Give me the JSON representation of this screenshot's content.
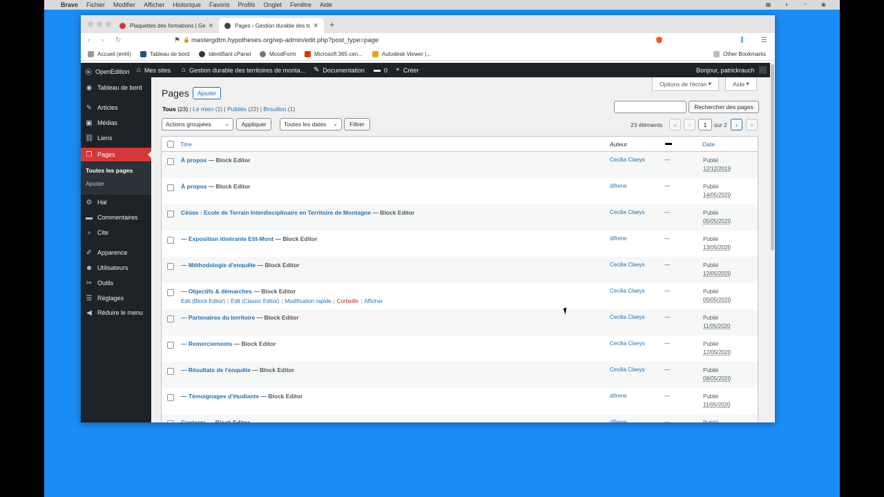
{
  "macmenu": {
    "app": "Brave",
    "items": [
      "Fichier",
      "Modifier",
      "Afficher",
      "Historique",
      "Favoris",
      "Profils",
      "Onglet",
      "Fenêtre",
      "Aide"
    ]
  },
  "browser": {
    "tabs": [
      {
        "label": "Plaquettes des formations | Ges",
        "icon_color": "#d63638"
      },
      {
        "label": "Pages ‹ Gestion durable des terr",
        "icon_color": "#3c434a"
      }
    ],
    "url": "mastergdtm.hypotheses.org/wp-admin/edit.php?post_type=page",
    "bookmarks": [
      {
        "label": "Accueil (ent4)",
        "color": "#999999"
      },
      {
        "label": "Tableau de bord",
        "color": "#1d4f91"
      },
      {
        "label": "Identifiant cPanel",
        "color": "#333333"
      },
      {
        "label": "MoodForm",
        "color": "#777777"
      },
      {
        "label": "Microsoft 365 cen...",
        "color": "#d83b01"
      },
      {
        "label": "Autodesk Viewer |...",
        "color": "#e8a317"
      }
    ],
    "other_bookmarks": "Other Bookmarks"
  },
  "adminbar": {
    "openedition": "OpenEdition",
    "my_sites": "Mes sites",
    "site": "Gestion durable des territoires de monta...",
    "documentation": "Documentation",
    "comments": "0",
    "create": "Créer",
    "greeting": "Bonjour, patrickrauch"
  },
  "sidebar": {
    "items": [
      {
        "label": "Tableau de bord",
        "icon": "dashboard-icon",
        "glyph": "◉"
      },
      {
        "label": "Articles",
        "icon": "pin-icon",
        "glyph": "✎"
      },
      {
        "label": "Médias",
        "icon": "media-icon",
        "glyph": "▣"
      },
      {
        "label": "Liens",
        "icon": "link-icon",
        "glyph": "⛓"
      },
      {
        "label": "Pages",
        "icon": "pages-icon",
        "glyph": "❐"
      },
      {
        "label": "Hal",
        "icon": "gear-icon",
        "glyph": "⚙"
      },
      {
        "label": "Commentaires",
        "icon": "comment-icon",
        "glyph": "▬"
      },
      {
        "label": "Cite",
        "icon": "cite-icon",
        "glyph": "●"
      },
      {
        "label": "Apparence",
        "icon": "brush-icon",
        "glyph": "✐"
      },
      {
        "label": "Utilisateurs",
        "icon": "user-icon",
        "glyph": "☻"
      },
      {
        "label": "Outils",
        "icon": "wrench-icon",
        "glyph": "✂"
      },
      {
        "label": "Réglages",
        "icon": "settings-icon",
        "glyph": "☰"
      },
      {
        "label": "Réduire le menu",
        "icon": "collapse-icon",
        "glyph": "◀"
      }
    ],
    "submenu": [
      "Toutes les pages",
      "Ajouter"
    ]
  },
  "main": {
    "title": "Pages",
    "add_new": "Ajouter",
    "screen_options": "Options de l'écran",
    "help": "Aide",
    "filters": {
      "all": "Tous",
      "all_count": "(23)",
      "mine": "Le mien",
      "mine_count": "(1)",
      "published": "Publiés",
      "published_count": "(22)",
      "draft": "Brouillon",
      "draft_count": "(1)"
    },
    "bulk_actions": "Actions groupées",
    "apply": "Appliquer",
    "all_dates": "Toutes les dates",
    "filter": "Filtrer",
    "search_button": "Rechercher des pages",
    "items_count": "23 éléments",
    "page_current": "1",
    "page_total": "sur 2",
    "columns": {
      "title": "Titre",
      "author": "Auteur",
      "date": "Date"
    },
    "rows": [
      {
        "title": "À propos",
        "state": "— Block Editor",
        "author": "Cecilia Claeys",
        "comments": "—",
        "status": "Publié",
        "date": "12/12/2019"
      },
      {
        "title": "À propos",
        "state": "— Block Editor",
        "author": "difrene",
        "comments": "—",
        "status": "Publié",
        "date": "14/05/2020"
      },
      {
        "title": "Céüse : Ecole de Terrain Interdisciplinaire en Territoire de Montagne",
        "state": "— Block Editor",
        "author": "Cecilia Claeys",
        "comments": "—",
        "status": "Publié",
        "date": "05/05/2020"
      },
      {
        "title": "— Exposition itinérante Etit-Mont",
        "state": "— Block Editor",
        "author": "difrene",
        "comments": "—",
        "status": "Publié",
        "date": "13/05/2020"
      },
      {
        "title": "— Méthodologie d'enquête",
        "state": "— Block Editor",
        "author": "Cecilia Claeys",
        "comments": "—",
        "status": "Publié",
        "date": "12/05/2020"
      },
      {
        "title": "— Objectifs & démarches",
        "state": "— Block Editor",
        "author": "Cecilia Claeys",
        "comments": "—",
        "status": "Publié",
        "date": "05/05/2020"
      },
      {
        "title": "— Partenaires du territoire",
        "state": "— Block Editor",
        "author": "Cecilia Claeys",
        "comments": "—",
        "status": "Publié",
        "date": "11/05/2020"
      },
      {
        "title": "— Remerciements",
        "state": "— Block Editor",
        "author": "Cecilia Claeys",
        "comments": "—",
        "status": "Publié",
        "date": "12/05/2020"
      },
      {
        "title": "— Résultats de l'enquête",
        "state": "— Block Editor",
        "author": "Cecilia Claeys",
        "comments": "—",
        "status": "Publié",
        "date": "08/05/2020"
      },
      {
        "title": "— Témoignages d'étudiants",
        "state": "— Block Editor",
        "author": "difrene",
        "comments": "—",
        "status": "Publié",
        "date": "11/05/2020"
      },
      {
        "title": "Contacts",
        "state": "— Block Editor",
        "author": "difrene",
        "comments": "—",
        "status": "Publié",
        "date": ""
      }
    ],
    "row_actions": {
      "edit_block": "Edit (Block Editor)",
      "edit_classic": "Edit (Classic Editor)",
      "quick_edit": "Modification rapide",
      "trash": "Corbeille",
      "view": "Afficher"
    }
  }
}
